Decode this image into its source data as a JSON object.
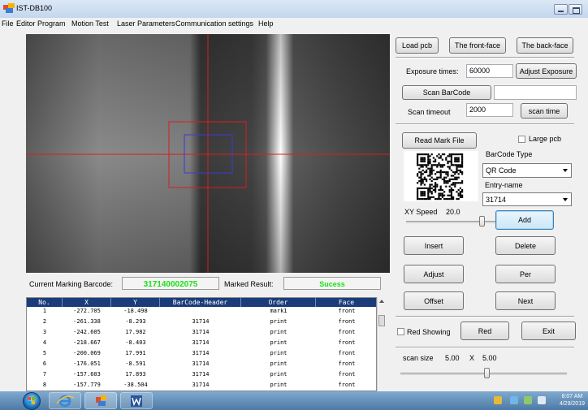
{
  "window": {
    "title": "IST-DB100"
  },
  "menu": [
    "File",
    "Editor Program",
    "Motion Test",
    "Laser Parameters",
    "Communication settings",
    "Help"
  ],
  "top_buttons": {
    "load_pcb": "Load pcb",
    "front_face": "The front-face",
    "back_face": "The back-face"
  },
  "exposure": {
    "label": "Exposure times:",
    "value": "60000",
    "adjust": "Adjust Exposure"
  },
  "scan": {
    "button": "Scan BarCode",
    "result": "",
    "timeout_label": "Scan timeout",
    "timeout_value": "2000",
    "time_button": "scan time"
  },
  "mark": {
    "read_button": "Read Mark File",
    "large_pcb": "Large pcb",
    "barcode_type_label": "BarCode Type",
    "barcode_type_value": "QR Code",
    "entry_label": "Entry-name",
    "entry_value": "31714",
    "xy_speed_label": "XY Speed",
    "xy_speed_value": "20.0",
    "xy_speed_level": 0.45
  },
  "actions": {
    "add": "Add",
    "insert": "Insert",
    "delete": "Delete",
    "adjust": "Adjust",
    "per": "Per",
    "offset": "Offset",
    "next": "Next"
  },
  "red": {
    "showing": "Red Showing",
    "red": "Red",
    "exit": "Exit"
  },
  "scan_size": {
    "label": "scan size",
    "x": "5.00",
    "sep": "X",
    "y": "5.00",
    "level": 0.5
  },
  "status": {
    "barcode_label": "Current Marking Barcode:",
    "barcode_value": "317140002075",
    "result_label": "Marked Result:",
    "result_value": "Sucess",
    "value_color": "#19e019"
  },
  "table": {
    "columns": [
      "No.",
      "X",
      "Y",
      "BarCode-Header",
      "Order",
      "Face"
    ],
    "rows": [
      [
        "1",
        "-272.705",
        "-18.498",
        "",
        "mark1",
        "front"
      ],
      [
        "2",
        "-261.338",
        "-8.293",
        "31714",
        "print",
        "front"
      ],
      [
        "3",
        "-242.605",
        "17.982",
        "31714",
        "print",
        "front"
      ],
      [
        "4",
        "-218.667",
        "-8.403",
        "31714",
        "print",
        "front"
      ],
      [
        "5",
        "-200.069",
        "17.991",
        "31714",
        "print",
        "front"
      ],
      [
        "6",
        "-176.051",
        "-8.591",
        "31714",
        "print",
        "front"
      ],
      [
        "7",
        "-157.603",
        "17.893",
        "31714",
        "print",
        "front"
      ],
      [
        "8",
        "-157.779",
        "-38.504",
        "31714",
        "print",
        "front"
      ]
    ],
    "header_color": "#1a3c7a"
  },
  "taskbar": {
    "time": "8:07 AM",
    "date": "4/29/2019"
  }
}
